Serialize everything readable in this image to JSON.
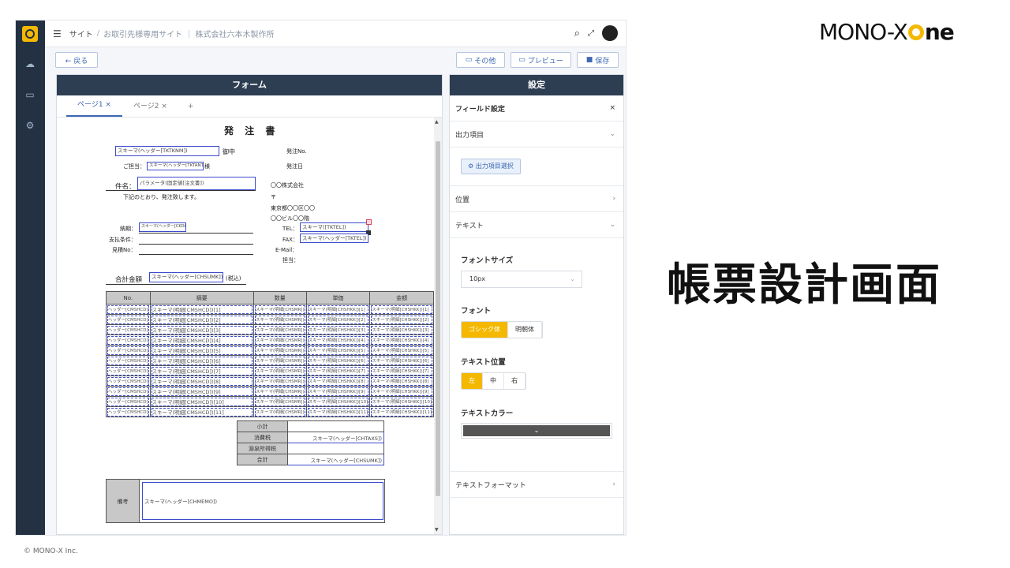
{
  "brand": {
    "part1": "MONO-X",
    "part2": "ne"
  },
  "headline": "帳票設計画面",
  "copyright": "© MONO-X Inc.",
  "topbar": {
    "breadcrumb_site": "サイト",
    "breadcrumb_sep": "/",
    "breadcrumb_page": "お取引先様専用サイト ｜ 株式会社六本木製作所"
  },
  "toolbar": {
    "back": "← 戻る",
    "other": "その他",
    "preview": "プレビュー",
    "save": "保存"
  },
  "form_panel": {
    "title": "フォーム",
    "tabs": [
      "ページ1 ×",
      "ページ2 ×"
    ],
    "tab_add": "+"
  },
  "doc": {
    "title": "発 注 書",
    "field_tktknm": "スキーマ(ヘッダー[TKTKNM])",
    "onchu": "御中",
    "tantou_label": "ご担当：",
    "field_tktant": "スキーマ(ヘッダー[TKTANT])",
    "sama": "様",
    "order_no": "発注No.",
    "order_date": "発注日",
    "kenmei_label": "件名：",
    "field_kenmei": "パラメータ(固定値[注文書])",
    "greeting": "下記のとおり、発注致します。",
    "company": "〇〇株式会社",
    "postal": "〒",
    "address1": "東京都〇〇区〇〇",
    "address2": "〇〇ビル〇〇階",
    "tel_label": "TEL：",
    "field_tel": "スキーマ([TKTEL])",
    "fax_label": "FAX：",
    "field_fax": "スキーマ(ヘッダー[TKTEL])",
    "email_label": "E-Mail：",
    "tantou2": "担当：",
    "noki_label": "納期：",
    "field_noki": "スキーマ(ヘッダー[CKDATE])",
    "shiharai_label": "支払条件：",
    "mitsumori_label": "見積No：",
    "total_label": "合計金額",
    "field_total": "スキーマ(ヘッダー[CHSUMK])",
    "tax_incl": "(税込)",
    "table_headers": [
      "No.",
      "摘要",
      "数量",
      "単価",
      "金額"
    ],
    "rows": [
      {
        "no": "ヘッダー[CMSHCD]",
        "desc": "スキーマ(明細[CMSHCD])[1]",
        "qty": "スキーマ(明細[CHSMR])",
        "price": "スキーマ(明細[CHSHKK])[1]",
        "amt": "スキーマ(明細[CHSHKK])[1]"
      },
      {
        "no": "ヘッダー[CMSHCD]",
        "desc": "スキーマ(明細[CMSHCD])[2]",
        "qty": "スキーマ(明細[CHSMR])",
        "price": "スキーマ(明細[CHSHKK])[2]",
        "amt": "スキーマ(明細[CHSHKK])[2]"
      },
      {
        "no": "ヘッダー[CMSHCD]",
        "desc": "スキーマ(明細[CMSHCD])[3]",
        "qty": "スキーマ(明細[CHSMR])",
        "price": "スキーマ(明細[CHSHKK])[3]",
        "amt": "スキーマ(明細[CHSHKK])[3]"
      },
      {
        "no": "ヘッダー[CMSHCD]",
        "desc": "スキーマ(明細[CMSHCD])[4]",
        "qty": "スキーマ(明細[CHSMR])",
        "price": "スキーマ(明細[CHSHKK])[4]",
        "amt": "スキーマ(明細[CHSHKK])[4]"
      },
      {
        "no": "ヘッダー[CMSHCD]",
        "desc": "スキーマ(明細[CMSHCD])[5]",
        "qty": "スキーマ(明細[CHSMR])",
        "price": "スキーマ(明細[CHSHKK])[5]",
        "amt": "スキーマ(明細[CHSHKK])[5]"
      },
      {
        "no": "ヘッダー[CMSHCD]",
        "desc": "スキーマ(明細[CMSHCD])[6]",
        "qty": "スキーマ(明細[CHSMR])",
        "price": "スキーマ(明細[CHSHKK])[6]",
        "amt": "スキーマ(明細[CHSHKK])[6]"
      },
      {
        "no": "ヘッダー[CMSHCD]",
        "desc": "スキーマ(明細[CMSHCD])[7]",
        "qty": "スキーマ(明細[CHSMR])",
        "price": "スキーマ(明細[CHSHKK])[7]",
        "amt": "スキーマ(明細[CHSHKK])[7]"
      },
      {
        "no": "ヘッダー[CMSHCD]",
        "desc": "スキーマ(明細[CMSHCD])[8]",
        "qty": "スキーマ(明細[CHSMR])",
        "price": "スキーマ(明細[CHSHKK])[8]",
        "amt": "スキーマ(明細[CHSHKK])[8]"
      },
      {
        "no": "ヘッダー[CMSHCD]",
        "desc": "スキーマ(明細[CMSHCD])[9]",
        "qty": "スキーマ(明細[CHSMR])",
        "price": "スキーマ(明細[CHSHKK])[9]",
        "amt": "スキーマ(明細[CHSHKK])[9]"
      },
      {
        "no": "ヘッダー[CMSHCD]",
        "desc": "スキーマ(明細[CMSHCD])[10]",
        "qty": "スキーマ(明細[CHSMR])",
        "price": "スキーマ(明細[CHSHKK])[10]",
        "amt": "スキーマ(明細[CHSHKK])[10]"
      },
      {
        "no": "ヘッダー[CMSHCD]",
        "desc": "スキーマ(明細[CMSHCD])[11]",
        "qty": "スキーマ(明細[CHSMR])",
        "price": "スキーマ(明細[CHSHKK])[11]",
        "amt": "スキーマ(明細[CHSHKK])[11]"
      }
    ],
    "totals": [
      {
        "label": "小計",
        "value": ""
      },
      {
        "label": "消費税",
        "value": "スキーマ(ヘッダー[CHTAXS])"
      },
      {
        "label": "源泉所得税",
        "value": ""
      },
      {
        "label": "合計",
        "value": "スキーマ(ヘッダー[CHSUMK])"
      }
    ],
    "remarks_label": "備考",
    "field_remarks": "スキーマ(ヘッダー[CHMEMO])"
  },
  "settings": {
    "title": "設定",
    "field_settings": "フィールド設定",
    "close": "×",
    "output_item": "出力項目",
    "output_select_btn": "出力項目選択",
    "position": "位置",
    "text": "テキスト",
    "font_size_label": "フォントサイズ",
    "font_size_value": "10px",
    "font_label": "フォント",
    "font_options": [
      "ゴシック体",
      "明朝体"
    ],
    "text_pos_label": "テキスト位置",
    "text_pos_options": [
      "左",
      "中",
      "右"
    ],
    "text_color_label": "テキストカラー",
    "text_color_value": "#555555",
    "text_format": "テキストフォーマット"
  }
}
